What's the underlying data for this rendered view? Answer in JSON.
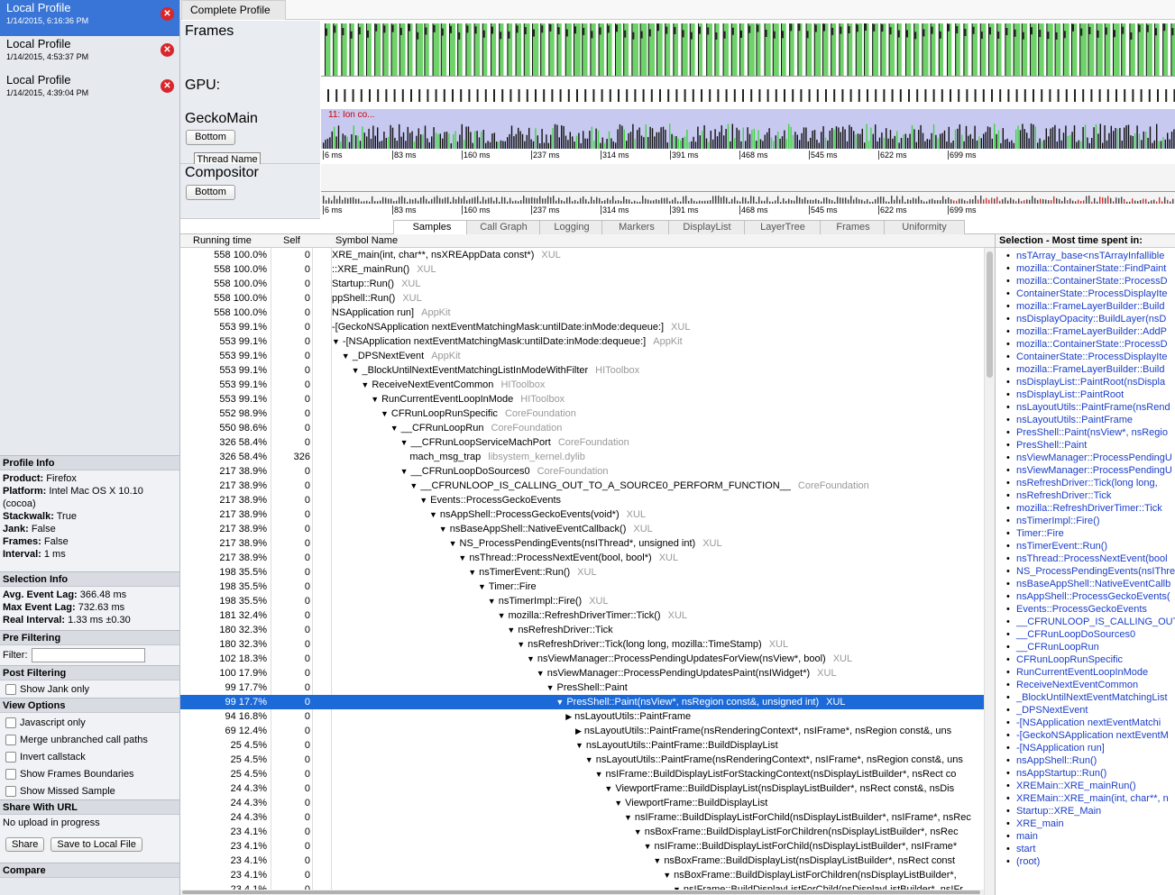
{
  "profiles": [
    {
      "name": "Local Profile",
      "date": "1/14/2015, 6:16:36 PM",
      "selected": true
    },
    {
      "name": "Local Profile",
      "date": "1/14/2015, 4:53:37 PM",
      "selected": false
    },
    {
      "name": "Local Profile",
      "date": "1/14/2015, 4:39:04 PM",
      "selected": false
    }
  ],
  "profile_info": {
    "header": "Profile Info",
    "product_label": "Product:",
    "product": "Firefox",
    "platform_label": "Platform:",
    "platform": "Intel Mac OS X 10.10 (cocoa)",
    "stackwalk_label": "Stackwalk:",
    "stackwalk": "True",
    "jank_label": "Jank:",
    "jank": "False",
    "frames_label": "Frames:",
    "frames": "False",
    "interval_label": "Interval:",
    "interval": "1 ms"
  },
  "selection_info": {
    "header": "Selection Info",
    "avg_label": "Avg. Event Lag:",
    "avg": "366.48 ms",
    "max_label": "Max Event Lag:",
    "max": "732.63 ms",
    "real_label": "Real Interval:",
    "real": "1.33 ms ±0.30"
  },
  "pre_filtering": {
    "header": "Pre Filtering",
    "filter_label": "Filter:",
    "filter_value": ""
  },
  "post_filtering": {
    "header": "Post Filtering",
    "show_jank": "Show Jank only"
  },
  "view_options": {
    "header": "View Options",
    "items": [
      "Javascript only",
      "Merge unbranched call paths",
      "Invert callstack",
      "Show Frames Boundaries",
      "Show Missed Sample"
    ]
  },
  "share": {
    "header": "Share With URL",
    "status": "No upload in progress",
    "share_btn": "Share",
    "save_btn": "Save to Local File"
  },
  "compare": {
    "header": "Compare"
  },
  "top_tab": "Complete Profile",
  "tracks": {
    "frames": "Frames",
    "gpu": "GPU:",
    "gecko": "GeckoMain",
    "gecko_btn": "Bottom",
    "gecko_marker": "11: Ion co...",
    "thread_tooltip": "Thread Name",
    "compositor": "Compositor",
    "compositor_btn": "Bottom",
    "ms_labels": [
      "6 ms",
      "83 ms",
      "160 ms",
      "237 ms",
      "314 ms",
      "391 ms",
      "468 ms",
      "545 ms",
      "622 ms",
      "699 ms"
    ]
  },
  "subtabs": [
    "Samples",
    "Call Graph",
    "Logging",
    "Markers",
    "DisplayList",
    "LayerTree",
    "Frames",
    "Uniformity"
  ],
  "tree": {
    "col_running": "Running time",
    "col_self": "Self",
    "col_symbol": "Symbol Name",
    "rows": [
      {
        "count": "558",
        "pct": "100.0%",
        "self": "0",
        "indent": 0,
        "arrow": "",
        "sym": "XRE_main(int, char**, nsXREAppData const*)",
        "lib": "XUL"
      },
      {
        "count": "558",
        "pct": "100.0%",
        "self": "0",
        "indent": 0,
        "arrow": "",
        "sym": "::XRE_mainRun()",
        "lib": "XUL"
      },
      {
        "count": "558",
        "pct": "100.0%",
        "self": "0",
        "indent": 0,
        "arrow": "",
        "sym": "Startup::Run()",
        "lib": "XUL"
      },
      {
        "count": "558",
        "pct": "100.0%",
        "self": "0",
        "indent": 0,
        "arrow": "",
        "sym": "ppShell::Run()",
        "lib": "XUL"
      },
      {
        "count": "558",
        "pct": "100.0%",
        "self": "0",
        "indent": 0,
        "arrow": "",
        "sym": "NSApplication run]",
        "lib": "AppKit"
      },
      {
        "count": "553",
        "pct": "99.1%",
        "self": "0",
        "indent": 0,
        "arrow": "",
        "sym": "-[GeckoNSApplication nextEventMatchingMask:untilDate:inMode:dequeue:]",
        "lib": "XUL"
      },
      {
        "count": "553",
        "pct": "99.1%",
        "self": "0",
        "indent": 0,
        "arrow": "▼",
        "sym": "-[NSApplication nextEventMatchingMask:untilDate:inMode:dequeue:]",
        "lib": "AppKit"
      },
      {
        "count": "553",
        "pct": "99.1%",
        "self": "0",
        "indent": 1,
        "arrow": "▼",
        "sym": "_DPSNextEvent",
        "lib": "AppKit"
      },
      {
        "count": "553",
        "pct": "99.1%",
        "self": "0",
        "indent": 2,
        "arrow": "▼",
        "sym": "_BlockUntilNextEventMatchingListInModeWithFilter",
        "lib": "HIToolbox"
      },
      {
        "count": "553",
        "pct": "99.1%",
        "self": "0",
        "indent": 3,
        "arrow": "▼",
        "sym": "ReceiveNextEventCommon",
        "lib": "HIToolbox"
      },
      {
        "count": "553",
        "pct": "99.1%",
        "self": "0",
        "indent": 4,
        "arrow": "▼",
        "sym": "RunCurrentEventLoopInMode",
        "lib": "HIToolbox"
      },
      {
        "count": "552",
        "pct": "98.9%",
        "self": "0",
        "indent": 5,
        "arrow": "▼",
        "sym": "CFRunLoopRunSpecific",
        "lib": "CoreFoundation"
      },
      {
        "count": "550",
        "pct": "98.6%",
        "self": "0",
        "indent": 6,
        "arrow": "▼",
        "sym": "__CFRunLoopRun",
        "lib": "CoreFoundation"
      },
      {
        "count": "326",
        "pct": "58.4%",
        "self": "0",
        "indent": 7,
        "arrow": "▼",
        "sym": "__CFRunLoopServiceMachPort",
        "lib": "CoreFoundation"
      },
      {
        "count": "326",
        "pct": "58.4%",
        "self": "326",
        "indent": 8,
        "arrow": "",
        "sym": "mach_msg_trap",
        "lib": "libsystem_kernel.dylib"
      },
      {
        "count": "217",
        "pct": "38.9%",
        "self": "0",
        "indent": 7,
        "arrow": "▼",
        "sym": "__CFRunLoopDoSources0",
        "lib": "CoreFoundation"
      },
      {
        "count": "217",
        "pct": "38.9%",
        "self": "0",
        "indent": 8,
        "arrow": "▼",
        "sym": "__CFRUNLOOP_IS_CALLING_OUT_TO_A_SOURCE0_PERFORM_FUNCTION__",
        "lib": "CoreFoundation"
      },
      {
        "count": "217",
        "pct": "38.9%",
        "self": "0",
        "indent": 9,
        "arrow": "▼",
        "sym": "Events::ProcessGeckoEvents",
        "lib": ""
      },
      {
        "count": "217",
        "pct": "38.9%",
        "self": "0",
        "indent": 10,
        "arrow": "▼",
        "sym": "nsAppShell::ProcessGeckoEvents(void*)",
        "lib": "XUL"
      },
      {
        "count": "217",
        "pct": "38.9%",
        "self": "0",
        "indent": 11,
        "arrow": "▼",
        "sym": "nsBaseAppShell::NativeEventCallback()",
        "lib": "XUL"
      },
      {
        "count": "217",
        "pct": "38.9%",
        "self": "0",
        "indent": 12,
        "arrow": "▼",
        "sym": "NS_ProcessPendingEvents(nsIThread*, unsigned int)",
        "lib": "XUL"
      },
      {
        "count": "217",
        "pct": "38.9%",
        "self": "0",
        "indent": 13,
        "arrow": "▼",
        "sym": "nsThread::ProcessNextEvent(bool, bool*)",
        "lib": "XUL"
      },
      {
        "count": "198",
        "pct": "35.5%",
        "self": "0",
        "indent": 14,
        "arrow": "▼",
        "sym": "nsTimerEvent::Run()",
        "lib": "XUL"
      },
      {
        "count": "198",
        "pct": "35.5%",
        "self": "0",
        "indent": 15,
        "arrow": "▼",
        "sym": "Timer::Fire",
        "lib": ""
      },
      {
        "count": "198",
        "pct": "35.5%",
        "self": "0",
        "indent": 16,
        "arrow": "▼",
        "sym": "nsTimerImpl::Fire()",
        "lib": "XUL"
      },
      {
        "count": "181",
        "pct": "32.4%",
        "self": "0",
        "indent": 17,
        "arrow": "▼",
        "sym": "mozilla::RefreshDriverTimer::Tick()",
        "lib": "XUL"
      },
      {
        "count": "180",
        "pct": "32.3%",
        "self": "0",
        "indent": 18,
        "arrow": "▼",
        "sym": "nsRefreshDriver::Tick",
        "lib": ""
      },
      {
        "count": "180",
        "pct": "32.3%",
        "self": "0",
        "indent": 19,
        "arrow": "▼",
        "sym": "nsRefreshDriver::Tick(long long, mozilla::TimeStamp)",
        "lib": "XUL"
      },
      {
        "count": "102",
        "pct": "18.3%",
        "self": "0",
        "indent": 20,
        "arrow": "▼",
        "sym": "nsViewManager::ProcessPendingUpdatesForView(nsView*, bool)",
        "lib": "XUL"
      },
      {
        "count": "100",
        "pct": "17.9%",
        "self": "0",
        "indent": 21,
        "arrow": "▼",
        "sym": "nsViewManager::ProcessPendingUpdatesPaint(nsIWidget*)",
        "lib": "XUL"
      },
      {
        "count": "99",
        "pct": "17.7%",
        "self": "0",
        "indent": 22,
        "arrow": "▼",
        "sym": "PresShell::Paint",
        "lib": ""
      },
      {
        "count": "99",
        "pct": "17.7%",
        "self": "0",
        "indent": 23,
        "arrow": "▼",
        "sym": "PresShell::Paint(nsView*, nsRegion const&, unsigned int)",
        "lib": "XUL",
        "selected": true
      },
      {
        "count": "94",
        "pct": "16.8%",
        "self": "0",
        "indent": 24,
        "arrow": "▶",
        "sym": "nsLayoutUtils::PaintFrame",
        "lib": ""
      },
      {
        "count": "69",
        "pct": "12.4%",
        "self": "0",
        "indent": 25,
        "arrow": "▶",
        "sym": "nsLayoutUtils::PaintFrame(nsRenderingContext*, nsIFrame*, nsRegion const&, uns",
        "lib": ""
      },
      {
        "count": "25",
        "pct": "4.5%",
        "self": "0",
        "indent": 25,
        "arrow": "▼",
        "sym": "nsLayoutUtils::PaintFrame::BuildDisplayList",
        "lib": ""
      },
      {
        "count": "25",
        "pct": "4.5%",
        "self": "0",
        "indent": 26,
        "arrow": "▼",
        "sym": "nsLayoutUtils::PaintFrame(nsRenderingContext*, nsIFrame*, nsRegion const&, uns",
        "lib": ""
      },
      {
        "count": "25",
        "pct": "4.5%",
        "self": "0",
        "indent": 27,
        "arrow": "▼",
        "sym": "nsIFrame::BuildDisplayListForStackingContext(nsDisplayListBuilder*, nsRect co",
        "lib": ""
      },
      {
        "count": "24",
        "pct": "4.3%",
        "self": "0",
        "indent": 28,
        "arrow": "▼",
        "sym": "ViewportFrame::BuildDisplayList(nsDisplayListBuilder*, nsRect const&, nsDis",
        "lib": ""
      },
      {
        "count": "24",
        "pct": "4.3%",
        "self": "0",
        "indent": 29,
        "arrow": "▼",
        "sym": "ViewportFrame::BuildDisplayList",
        "lib": ""
      },
      {
        "count": "24",
        "pct": "4.3%",
        "self": "0",
        "indent": 30,
        "arrow": "▼",
        "sym": "nsIFrame::BuildDisplayListForChild(nsDisplayListBuilder*, nsIFrame*, nsRec",
        "lib": ""
      },
      {
        "count": "23",
        "pct": "4.1%",
        "self": "0",
        "indent": 31,
        "arrow": "▼",
        "sym": "nsBoxFrame::BuildDisplayListForChildren(nsDisplayListBuilder*, nsRec",
        "lib": ""
      },
      {
        "count": "23",
        "pct": "4.1%",
        "self": "0",
        "indent": 32,
        "arrow": "▼",
        "sym": "nsIFrame::BuildDisplayListForChild(nsDisplayListBuilder*, nsIFrame*",
        "lib": ""
      },
      {
        "count": "23",
        "pct": "4.1%",
        "self": "0",
        "indent": 33,
        "arrow": "▼",
        "sym": "nsBoxFrame::BuildDisplayList(nsDisplayListBuilder*, nsRect const",
        "lib": ""
      },
      {
        "count": "23",
        "pct": "4.1%",
        "self": "0",
        "indent": 34,
        "arrow": "▼",
        "sym": "nsBoxFrame::BuildDisplayListForChildren(nsDisplayListBuilder*,",
        "lib": ""
      },
      {
        "count": "23",
        "pct": "4.1%",
        "self": "0",
        "indent": 35,
        "arrow": "▼",
        "sym": "nsIFrame::BuildDisplayListForChild(nsDisplayListBuilder*, nsIFr",
        "lib": ""
      }
    ]
  },
  "selection_panel": {
    "header": "Selection - Most time spent in:",
    "items": [
      "nsTArray_base<nsTArrayInfallible",
      "mozilla::ContainerState::FindPaint",
      "mozilla::ContainerState::ProcessD",
      "ContainerState::ProcessDisplayIte",
      "mozilla::FrameLayerBuilder::Build",
      "nsDisplayOpacity::BuildLayer(nsD",
      "mozilla::FrameLayerBuilder::AddP",
      "mozilla::ContainerState::ProcessD",
      "ContainerState::ProcessDisplayIte",
      "mozilla::FrameLayerBuilder::Build",
      "nsDisplayList::PaintRoot(nsDispla",
      "nsDisplayList::PaintRoot",
      "nsLayoutUtils::PaintFrame(nsRend",
      "nsLayoutUtils::PaintFrame",
      "PresShell::Paint(nsView*, nsRegio",
      "PresShell::Paint",
      "nsViewManager::ProcessPendingU",
      "nsViewManager::ProcessPendingU",
      "nsRefreshDriver::Tick(long long,",
      "nsRefreshDriver::Tick",
      "mozilla::RefreshDriverTimer::Tick",
      "nsTimerImpl::Fire()",
      "Timer::Fire",
      "nsTimerEvent::Run()",
      "nsThread::ProcessNextEvent(bool",
      "NS_ProcessPendingEvents(nsIThre",
      "nsBaseAppShell::NativeEventCallb",
      "nsAppShell::ProcessGeckoEvents(",
      "Events::ProcessGeckoEvents",
      "__CFRUNLOOP_IS_CALLING_OUT_",
      "__CFRunLoopDoSources0",
      "__CFRunLoopRun",
      "CFRunLoopRunSpecific",
      "RunCurrentEventLoopInMode",
      "ReceiveNextEventCommon",
      "_BlockUntilNextEventMatchingList",
      "_DPSNextEvent",
      "-[NSApplication nextEventMatchi",
      "-[GeckoNSApplication nextEventM",
      "-[NSApplication run]",
      "nsAppShell::Run()",
      "nsAppStartup::Run()",
      "XREMain::XRE_mainRun()",
      "XREMain::XRE_main(int, char**, n",
      "Startup::XRE_Main",
      "XRE_main",
      "main",
      "start",
      "(root)"
    ]
  }
}
